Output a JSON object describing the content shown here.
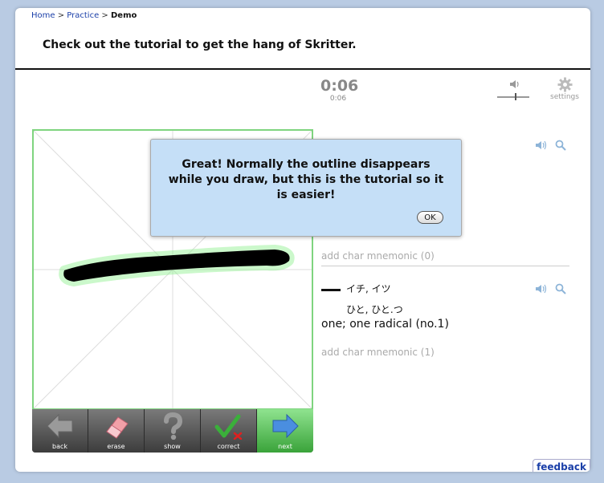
{
  "breadcrumb": {
    "home": "Home",
    "sep1": " > ",
    "practice": "Practice",
    "sep2": " > ",
    "current": "Demo"
  },
  "headline": "Check out the tutorial to get the hang of Skritter.",
  "timer": {
    "main": "0:06",
    "sub": "0:06"
  },
  "settings": {
    "label": "settings"
  },
  "volume": {
    "level": 0.55
  },
  "popup": {
    "message": "Great! Normally the outline disappears while you draw, but this is the tutorial so it is easier!",
    "ok_label": "OK"
  },
  "char1": {
    "mnemonic": "add char mnemonic (0)"
  },
  "char2": {
    "reading_on": "イチ, イツ",
    "reading_kun": "ひと, ひと.つ",
    "meaning": "one; one radical (no.1)",
    "mnemonic": "add char mnemonic (1)"
  },
  "toolbar": {
    "back": "back",
    "erase": "erase",
    "show": "show",
    "correct": "correct",
    "next": "next"
  },
  "feedback": "feedback",
  "colors": {
    "accent_green": "#7fd47f",
    "popup_bg": "#c5dff7",
    "link_blue": "#1a3fa8",
    "icon_blue": "#8db4d8"
  },
  "icons": {
    "speaker": "speaker-icon",
    "zoom": "magnifier-icon",
    "settings": "gear-icon",
    "back": "arrow-left-icon",
    "erase": "eraser-icon",
    "show": "question-mark-icon",
    "correct": "checkmark-icon",
    "next": "arrow-right-icon"
  }
}
